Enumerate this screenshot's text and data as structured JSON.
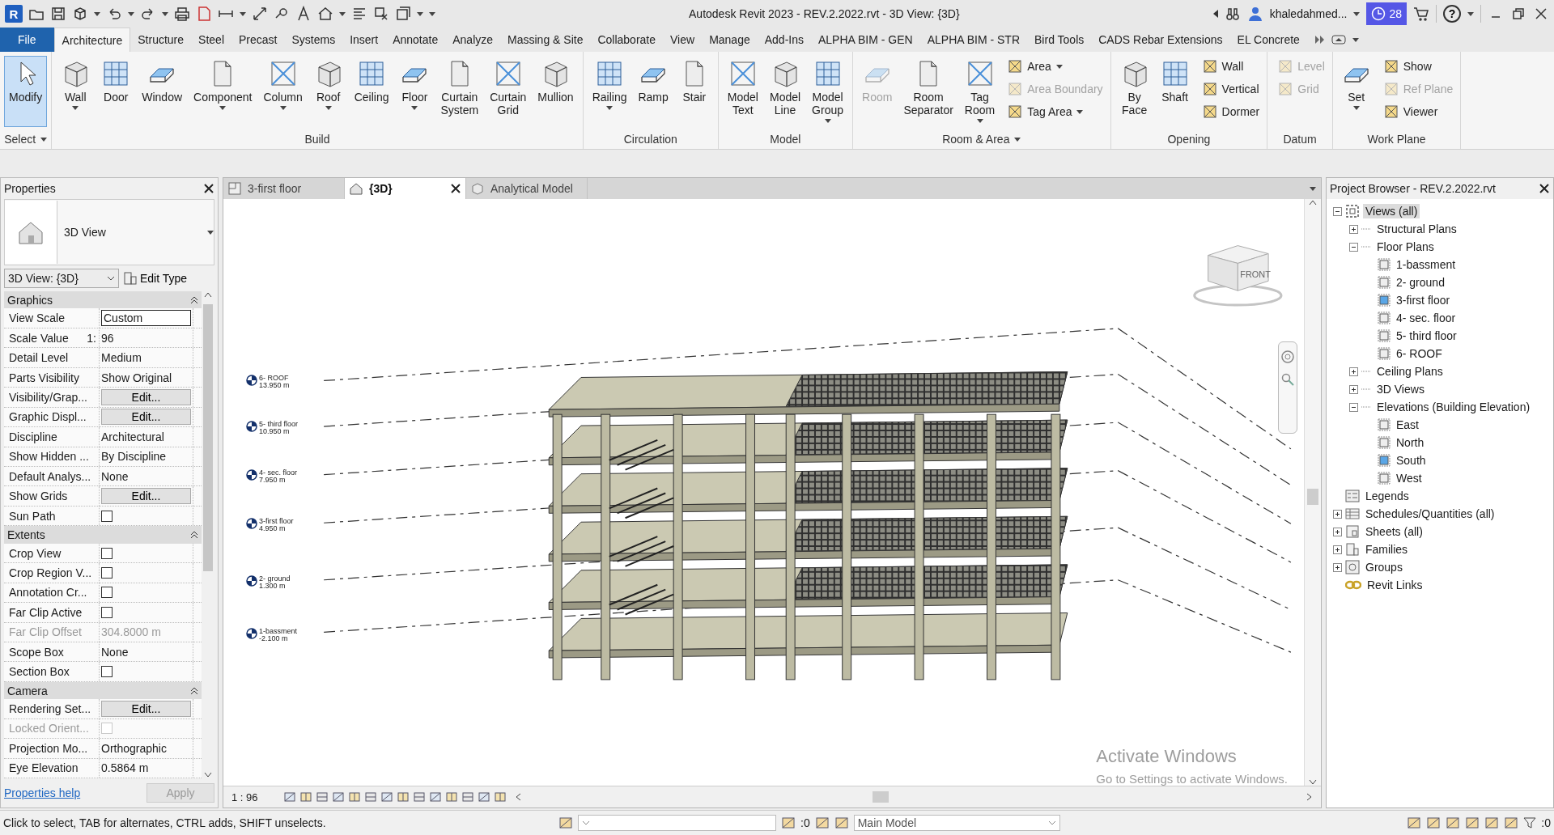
{
  "app": {
    "logo": "R",
    "title": "Autodesk Revit 2023 - REV.2.2022.rvt - 3D View: {3D}",
    "user": "khaledahmed...",
    "notifications": "28",
    "help": "?"
  },
  "ribbon": {
    "tabs": [
      {
        "label": "File",
        "kind": "file",
        "selected": false
      },
      {
        "label": "Architecture",
        "kind": "tab",
        "selected": true
      },
      {
        "label": "Structure",
        "kind": "tab",
        "selected": false
      },
      {
        "label": "Steel",
        "kind": "tab",
        "selected": false
      },
      {
        "label": "Precast",
        "kind": "tab",
        "selected": false
      },
      {
        "label": "Systems",
        "kind": "tab",
        "selected": false
      },
      {
        "label": "Insert",
        "kind": "tab",
        "selected": false
      },
      {
        "label": "Annotate",
        "kind": "tab",
        "selected": false
      },
      {
        "label": "Analyze",
        "kind": "tab",
        "selected": false
      },
      {
        "label": "Massing & Site",
        "kind": "tab",
        "selected": false
      },
      {
        "label": "Collaborate",
        "kind": "tab",
        "selected": false
      },
      {
        "label": "View",
        "kind": "tab",
        "selected": false
      },
      {
        "label": "Manage",
        "kind": "tab",
        "selected": false
      },
      {
        "label": "Add-Ins",
        "kind": "tab",
        "selected": false
      },
      {
        "label": "ALPHA BIM - GEN",
        "kind": "tab",
        "selected": false
      },
      {
        "label": "ALPHA BIM - STR",
        "kind": "tab",
        "selected": false
      },
      {
        "label": "Bird Tools",
        "kind": "tab",
        "selected": false
      },
      {
        "label": "CADS Rebar Extensions",
        "kind": "tab",
        "selected": false
      },
      {
        "label": "EL Concrete",
        "kind": "tab",
        "selected": false
      }
    ],
    "panels": [
      {
        "title": "Select",
        "menu": true,
        "items": [
          {
            "kind": "large",
            "label": "Modify",
            "dropdown": false,
            "disabled": false,
            "active": true
          }
        ]
      },
      {
        "title": "Build",
        "menu": false,
        "items": [
          {
            "kind": "large",
            "label": "Wall",
            "dropdown": true,
            "disabled": false,
            "active": false
          },
          {
            "kind": "large",
            "label": "Door",
            "dropdown": false,
            "disabled": false,
            "active": false
          },
          {
            "kind": "large",
            "label": "Window",
            "dropdown": false,
            "disabled": false,
            "active": false
          },
          {
            "kind": "large",
            "label": "Component",
            "dropdown": true,
            "disabled": false,
            "active": false
          },
          {
            "kind": "large",
            "label": "Column",
            "dropdown": true,
            "disabled": false,
            "active": false
          },
          {
            "kind": "large",
            "label": "Roof",
            "dropdown": true,
            "disabled": false,
            "active": false
          },
          {
            "kind": "large",
            "label": "Ceiling",
            "dropdown": false,
            "disabled": false,
            "active": false
          },
          {
            "kind": "large",
            "label": "Floor",
            "dropdown": true,
            "disabled": false,
            "active": false
          },
          {
            "kind": "large",
            "label": "Curtain System",
            "dropdown": false,
            "disabled": false,
            "active": false
          },
          {
            "kind": "large",
            "label": "Curtain Grid",
            "dropdown": false,
            "disabled": false,
            "active": false
          },
          {
            "kind": "large",
            "label": "Mullion",
            "dropdown": false,
            "disabled": false,
            "active": false
          }
        ]
      },
      {
        "title": "Circulation",
        "menu": false,
        "items": [
          {
            "kind": "large",
            "label": "Railing",
            "dropdown": true,
            "disabled": false,
            "active": false
          },
          {
            "kind": "large",
            "label": "Ramp",
            "dropdown": false,
            "disabled": false,
            "active": false
          },
          {
            "kind": "large",
            "label": "Stair",
            "dropdown": false,
            "disabled": false,
            "active": false
          }
        ]
      },
      {
        "title": "Model",
        "menu": false,
        "items": [
          {
            "kind": "large",
            "label": "Model Text",
            "dropdown": false,
            "disabled": false,
            "active": false
          },
          {
            "kind": "large",
            "label": "Model Line",
            "dropdown": false,
            "disabled": false,
            "active": false
          },
          {
            "kind": "large",
            "label": "Model Group",
            "dropdown": true,
            "disabled": false,
            "active": false
          }
        ]
      },
      {
        "title": "Room & Area",
        "menu": true,
        "items": [
          {
            "kind": "large",
            "label": "Room",
            "dropdown": false,
            "disabled": true,
            "active": false
          },
          {
            "kind": "large",
            "label": "Room Separator",
            "dropdown": false,
            "disabled": false,
            "active": false
          },
          {
            "kind": "large",
            "label": "Tag Room",
            "dropdown": true,
            "disabled": false,
            "active": false
          },
          {
            "kind": "stack",
            "items": [
              {
                "label": "Area",
                "dropdown": true,
                "disabled": false
              },
              {
                "label": "Area Boundary",
                "dropdown": false,
                "disabled": true
              },
              {
                "label": "Tag Area",
                "dropdown": true,
                "disabled": false
              }
            ]
          }
        ]
      },
      {
        "title": "Opening",
        "menu": false,
        "items": [
          {
            "kind": "large",
            "label": "By Face",
            "dropdown": false,
            "disabled": false,
            "active": false
          },
          {
            "kind": "large",
            "label": "Shaft",
            "dropdown": false,
            "disabled": false,
            "active": false
          },
          {
            "kind": "stack",
            "items": [
              {
                "label": "Wall",
                "dropdown": false,
                "disabled": false
              },
              {
                "label": "Vertical",
                "dropdown": false,
                "disabled": false
              },
              {
                "label": "Dormer",
                "dropdown": false,
                "disabled": false
              }
            ]
          }
        ]
      },
      {
        "title": "Datum",
        "menu": false,
        "items": [
          {
            "kind": "stack",
            "items": [
              {
                "label": "Level",
                "dropdown": false,
                "disabled": true
              },
              {
                "label": "Grid",
                "dropdown": false,
                "disabled": true
              }
            ]
          }
        ]
      },
      {
        "title": "Work Plane",
        "menu": false,
        "items": [
          {
            "kind": "large",
            "label": "Set",
            "dropdown": true,
            "disabled": false,
            "active": false
          },
          {
            "kind": "stack",
            "items": [
              {
                "label": "Show",
                "dropdown": false,
                "disabled": false
              },
              {
                "label": "Ref Plane",
                "dropdown": false,
                "disabled": true
              },
              {
                "label": "Viewer",
                "dropdown": false,
                "disabled": false
              }
            ]
          }
        ]
      }
    ]
  },
  "properties": {
    "title": "Properties",
    "type_name": "3D View",
    "instance": "3D View: {3D}",
    "edit_type": "Edit Type",
    "sections": [
      {
        "title": "Graphics",
        "expanded": true,
        "rows": [
          {
            "name": "View Scale",
            "kind": "field",
            "value": "Custom",
            "disabled": false
          },
          {
            "name": "Scale Value",
            "prefix": "1:",
            "kind": "text",
            "value": "96",
            "disabled": false
          },
          {
            "name": "Detail Level",
            "kind": "text",
            "value": "Medium",
            "disabled": false
          },
          {
            "name": "Parts Visibility",
            "kind": "text",
            "value": "Show Original",
            "disabled": false
          },
          {
            "name": "Visibility/Grap...",
            "kind": "button",
            "value": "Edit...",
            "disabled": false
          },
          {
            "name": "Graphic Displ...",
            "kind": "button",
            "value": "Edit...",
            "disabled": false
          },
          {
            "name": "Discipline",
            "kind": "text",
            "value": "Architectural",
            "disabled": false
          },
          {
            "name": "Show Hidden ...",
            "kind": "text",
            "value": "By Discipline",
            "disabled": false
          },
          {
            "name": "Default Analys...",
            "kind": "text",
            "value": "None",
            "disabled": false
          },
          {
            "name": "Show Grids",
            "kind": "button",
            "value": "Edit...",
            "disabled": false
          },
          {
            "name": "Sun Path",
            "kind": "checkbox",
            "checked": false,
            "disabled": false
          }
        ]
      },
      {
        "title": "Extents",
        "expanded": true,
        "rows": [
          {
            "name": "Crop View",
            "kind": "checkbox",
            "checked": false,
            "disabled": false
          },
          {
            "name": "Crop Region V...",
            "kind": "checkbox",
            "checked": false,
            "disabled": false
          },
          {
            "name": "Annotation Cr...",
            "kind": "checkbox",
            "checked": false,
            "disabled": false
          },
          {
            "name": "Far Clip Active",
            "kind": "checkbox",
            "checked": false,
            "disabled": false
          },
          {
            "name": "Far Clip Offset",
            "kind": "text",
            "value": "304.8000 m",
            "disabled": true
          },
          {
            "name": "Scope Box",
            "kind": "text",
            "value": "None",
            "disabled": false
          },
          {
            "name": "Section Box",
            "kind": "checkbox",
            "checked": false,
            "disabled": false
          }
        ]
      },
      {
        "title": "Camera",
        "expanded": true,
        "rows": [
          {
            "name": "Rendering Set...",
            "kind": "button",
            "value": "Edit...",
            "disabled": false
          },
          {
            "name": "Locked Orient...",
            "kind": "checkbox",
            "checked": false,
            "disabled": true
          },
          {
            "name": "Projection Mo...",
            "kind": "text",
            "value": "Orthographic",
            "disabled": false
          },
          {
            "name": "Eye Elevation",
            "kind": "text",
            "value": "0.5864 m",
            "disabled": false
          }
        ]
      }
    ],
    "help_link": "Properties help",
    "apply": "Apply",
    "apply_disabled": true
  },
  "view": {
    "tabs": [
      {
        "label": "3-first floor",
        "kind": "plan",
        "selected": false
      },
      {
        "label": "{3D}",
        "kind": "model",
        "selected": true
      },
      {
        "label": "Analytical Model",
        "kind": "analytical",
        "selected": false
      }
    ],
    "levels": [
      {
        "name": "6- ROOF",
        "elevation": "13.950 m"
      },
      {
        "name": "5- third floor",
        "elevation": "10.950 m"
      },
      {
        "name": "4- sec. floor",
        "elevation": "7.950 m"
      },
      {
        "name": "3-first floor",
        "elevation": "4.950 m"
      },
      {
        "name": "2- ground",
        "elevation": "1.300 m"
      },
      {
        "name": "1-bassment",
        "elevation": "-2.100 m"
      }
    ],
    "viewcube": "FRONT",
    "scale": "1 : 96"
  },
  "windows_notice": {
    "title": "Activate Windows",
    "text": "Go to Settings to activate Windows."
  },
  "browser": {
    "title": "Project Browser - REV.2.2022.rvt",
    "tree": [
      {
        "label": "Views (all)",
        "kind": "views",
        "expanded": true,
        "selected": true,
        "children": [
          {
            "label": "Structural Plans",
            "kind": "category",
            "expanded": false,
            "selected": false
          },
          {
            "label": "Floor Plans",
            "kind": "category",
            "expanded": true,
            "selected": false,
            "children": [
              {
                "label": "1-bassment",
                "kind": "view",
                "open": false,
                "selected": false
              },
              {
                "label": "2- ground",
                "kind": "view",
                "open": false,
                "selected": false
              },
              {
                "label": "3-first floor",
                "kind": "view",
                "open": true,
                "selected": false
              },
              {
                "label": "4- sec. floor",
                "kind": "view",
                "open": false,
                "selected": false
              },
              {
                "label": "5- third floor",
                "kind": "view",
                "open": false,
                "selected": false
              },
              {
                "label": "6- ROOF",
                "kind": "view",
                "open": false,
                "selected": false
              }
            ]
          },
          {
            "label": "Ceiling Plans",
            "kind": "category",
            "expanded": false,
            "selected": false
          },
          {
            "label": "3D Views",
            "kind": "category",
            "expanded": false,
            "selected": false
          },
          {
            "label": "Elevations (Building Elevation)",
            "kind": "category",
            "expanded": true,
            "selected": false,
            "children": [
              {
                "label": "East",
                "kind": "view",
                "open": false,
                "selected": false
              },
              {
                "label": "North",
                "kind": "view",
                "open": false,
                "selected": false
              },
              {
                "label": "South",
                "kind": "view",
                "open": true,
                "selected": false
              },
              {
                "label": "West",
                "kind": "view",
                "open": false,
                "selected": false
              }
            ]
          }
        ]
      },
      {
        "label": "Legends",
        "kind": "legends",
        "selected": false
      },
      {
        "label": "Schedules/Quantities (all)",
        "kind": "schedules",
        "expanded": false,
        "selected": false
      },
      {
        "label": "Sheets (all)",
        "kind": "sheets",
        "expanded": false,
        "selected": false
      },
      {
        "label": "Families",
        "kind": "families",
        "expanded": false,
        "selected": false
      },
      {
        "label": "Groups",
        "kind": "groups",
        "expanded": false,
        "selected": false
      },
      {
        "label": "Revit Links",
        "kind": "links",
        "selected": false
      }
    ]
  },
  "status": {
    "message": "Click to select, TAB for alternates, CTRL adds, SHIFT unselects.",
    "selection_count": ":0",
    "model": "Main Model",
    "filter_count": ":0"
  }
}
